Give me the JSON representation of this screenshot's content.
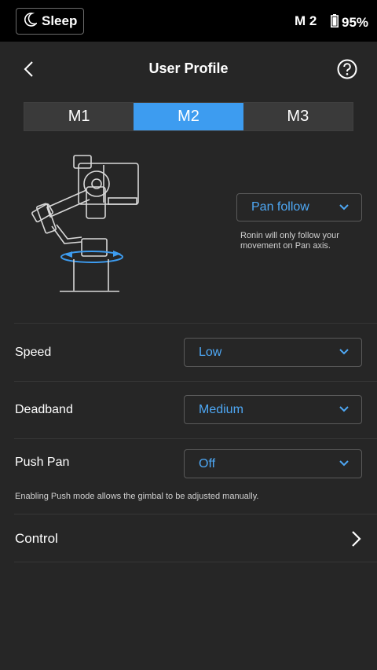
{
  "status_bar": {
    "sleep_label": "Sleep",
    "mode": "M 2",
    "battery": "95%",
    "icons": [
      "moon-icon",
      "battery-icon"
    ]
  },
  "header": {
    "title": "User Profile",
    "icons": [
      "back-chevron-icon",
      "help-icon"
    ]
  },
  "tabs": [
    {
      "label": "M1",
      "active": false
    },
    {
      "label": "M2",
      "active": true
    },
    {
      "label": "M3",
      "active": false
    }
  ],
  "follow_mode": {
    "value": "Pan follow",
    "description": "Ronin will only follow your movement on Pan axis."
  },
  "settings": {
    "speed": {
      "label": "Speed",
      "value": "Low"
    },
    "deadband": {
      "label": "Deadband",
      "value": "Medium"
    },
    "push_pan": {
      "label": "Push Pan",
      "value": "Off",
      "note": "Enabling Push mode allows the gimbal to be adjusted manually."
    }
  },
  "control": {
    "label": "Control"
  },
  "colors": {
    "accent": "#3d9cf0",
    "value_text": "#4ea8f5",
    "background": "#262626",
    "status_bar": "#000000"
  }
}
